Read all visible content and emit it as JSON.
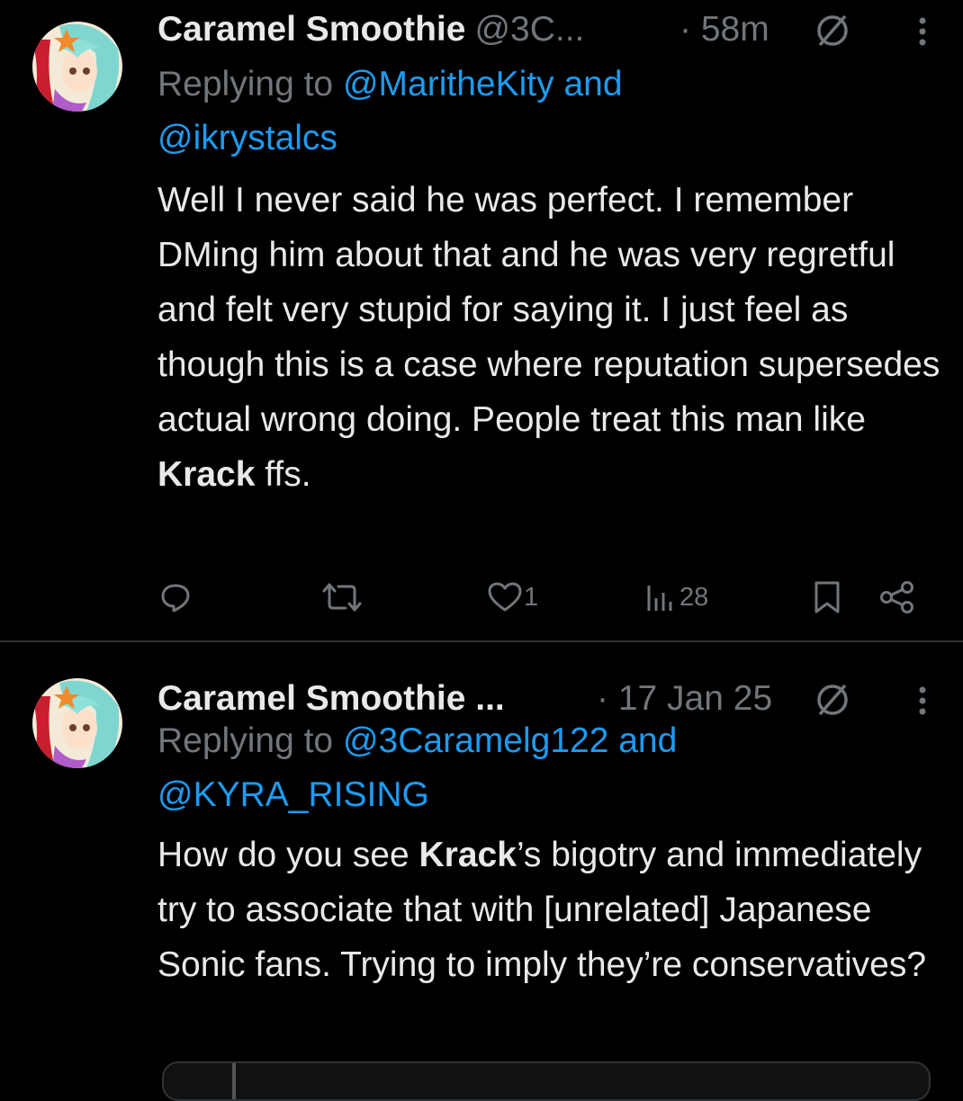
{
  "tweets": [
    {
      "display_name": "Caramel Smoothie",
      "handle": "@3C...",
      "time": "· 58m",
      "replying_prefix": "Replying to",
      "replying_line1": "@MaritheKity and",
      "replying_line2": "@ikrystalcs",
      "text_parts": [
        "Well I never said he was perfect. I remember DMing him about that and he was very regretful and felt very stupid for saying it. I just feel as though this is a case where reputation supersedes actual wrong doing. People treat this man like ",
        "Krack",
        " ffs."
      ],
      "like_count": "1",
      "view_count": "28"
    },
    {
      "display_name": "Caramel Smoothie ...",
      "time": "· 17 Jan 25",
      "replying_prefix": "Replying to",
      "replying_line1": "@3Caramelg122 and",
      "replying_line2": "@KYRA_RISING",
      "text_parts": [
        "How do you see ",
        "Krack",
        "’s bigotry and immediately try to associate that with [unrelated] Japanese Sonic fans. Trying to imply they’re conservatives?"
      ]
    }
  ],
  "icons": [
    "avatar",
    "mute-icon",
    "more-icon",
    "reply-icon",
    "retweet-icon",
    "like-icon",
    "views-icon",
    "bookmark-icon",
    "share-icon"
  ],
  "colors": {
    "background": "#000000",
    "text": "#e7e9ea",
    "secondary": "#71767b",
    "link": "#1d9bf0",
    "divider": "#2f3336"
  }
}
